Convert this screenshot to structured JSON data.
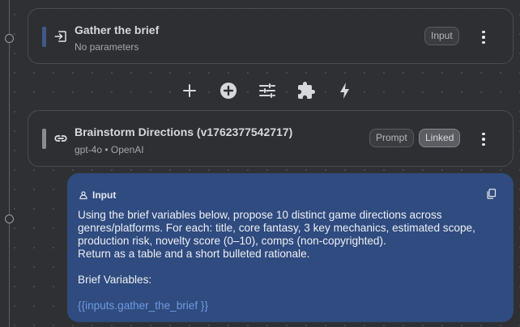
{
  "nodes": [
    {
      "title": "Gather the brief",
      "subtitle": "No parameters",
      "icon": "input-arrow-icon",
      "badges": [
        "Input"
      ]
    },
    {
      "title": "Brainstorm Directions (v1762377542717)",
      "subtitle": "gpt-4o • OpenAI",
      "icon": "link-icon",
      "badges": [
        "Prompt",
        "Linked"
      ]
    }
  ],
  "toolbar": {
    "buttons": [
      "plus-icon",
      "add-circle-icon",
      "sliders-icon",
      "puzzle-icon",
      "bolt-icon"
    ]
  },
  "prompt": {
    "label": "Input",
    "icon": "person-icon",
    "text": "Using the brief variables below, propose 10 distinct game directions across genres/platforms. For each: title, core fantasy, 3 key mechanics, estimated scope, production risk, novelty score (0–10), comps (non-copyrighted).\nReturn as a table and a short bulleted rationale.\n\nBrief Variables:",
    "variable": "{{inputs.gather_the_brief }}"
  },
  "colors": {
    "canvas": "#2f3033",
    "prompt_card": "#2f4b7f",
    "variable": "#6f9be0"
  }
}
